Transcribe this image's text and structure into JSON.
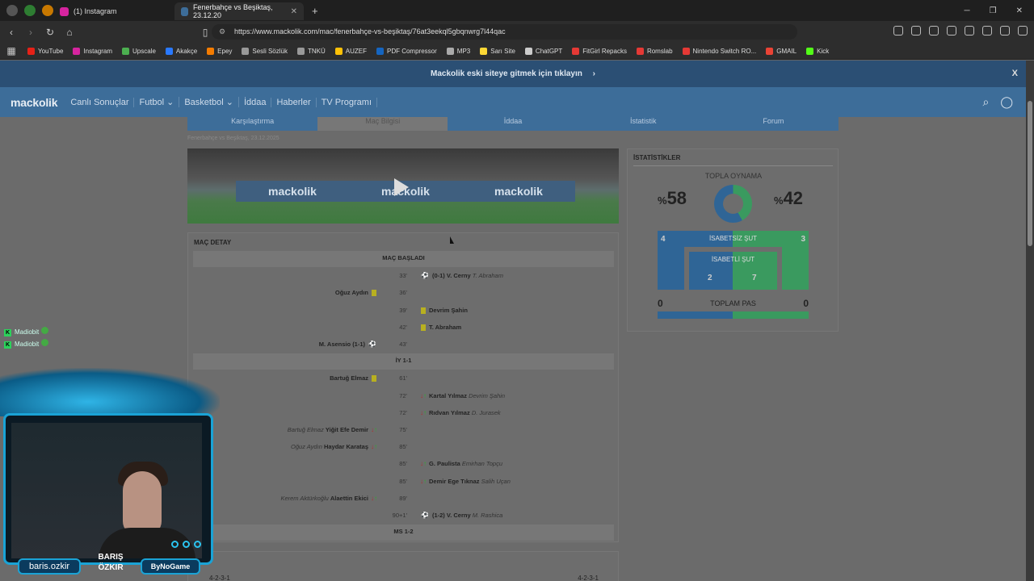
{
  "browser": {
    "tabs": [
      {
        "title": "(1) Instagram",
        "color": "#d6249f"
      },
      {
        "title": "Fenerbahçe vs Beşiktaş, 23.12.20",
        "color": "#3d6d99"
      }
    ],
    "new_tab": "+",
    "url": "https://www.mackolik.com/mac/fenerbahçe-vs-beşiktaş/76at3eekql5gbqnwrg7l44qac",
    "bookmarks": [
      {
        "label": "YouTube",
        "color": "#e62117"
      },
      {
        "label": "Instagram",
        "color": "#d6249f"
      },
      {
        "label": "Upscale",
        "color": "#4caf50"
      },
      {
        "label": "Akakçe",
        "color": "#2979ff"
      },
      {
        "label": "Epey",
        "color": "#f57c00"
      },
      {
        "label": "Sesli Sözlük",
        "color": "#999999"
      },
      {
        "label": "TNKÜ",
        "color": "#999999"
      },
      {
        "label": "AUZEF",
        "color": "#ffc107"
      },
      {
        "label": "PDF Compressor",
        "color": "#1565c0"
      },
      {
        "label": "MP3",
        "color": "#aaaaaa"
      },
      {
        "label": "Sarı Site",
        "color": "#fdd835"
      },
      {
        "label": "ChatGPT",
        "color": "#cccccc"
      },
      {
        "label": "FitGirl Repacks",
        "color": "#e53935"
      },
      {
        "label": "Romslab",
        "color": "#e53935"
      },
      {
        "label": "Nintendo Switch RO...",
        "color": "#e53935"
      },
      {
        "label": "GMAIL",
        "color": "#ea4335"
      },
      {
        "label": "Kick",
        "color": "#53fc18"
      }
    ]
  },
  "banner": {
    "text": "Mackolik eski siteye gitmek için tıklayın",
    "close": "X"
  },
  "nav": {
    "logo": "mackolik",
    "links": [
      "Canlı Sonuçlar",
      "Futbol ⌄",
      "Basketbol ⌄",
      "İddaa",
      "Haberler",
      "TV Programı"
    ]
  },
  "subtabs": [
    "Karşılaştırma",
    "Maç Bilgisi",
    "İddaa",
    "İstatistik",
    "Forum"
  ],
  "breadcrumb": "Fenerbahçe vs Beşiktaş, 23.12.2025",
  "video": {
    "brand": "mackolik"
  },
  "match_detail": {
    "title": "MAÇ DETAY",
    "events": [
      {
        "type": "hdr",
        "text": "MAÇ BAŞLADI"
      },
      {
        "min": "33'",
        "side": "r",
        "kind": "goal",
        "score": "(0-1)",
        "player": "V. Cerny",
        "assist": "T. Abraham"
      },
      {
        "min": "36'",
        "side": "l",
        "kind": "card",
        "player": "Oğuz Aydın"
      },
      {
        "min": "39'",
        "side": "r",
        "kind": "card",
        "player": "Devrim Şahin"
      },
      {
        "min": "42'",
        "side": "r",
        "kind": "card",
        "player": "T. Abraham"
      },
      {
        "min": "43'",
        "side": "l",
        "kind": "pen",
        "player": "M. Asensio",
        "score": "(1-1)"
      },
      {
        "type": "hdr",
        "text": "İY 1-1"
      },
      {
        "min": "61'",
        "side": "l",
        "kind": "card",
        "player": "Bartuğ Elmaz"
      },
      {
        "min": "72'",
        "side": "r",
        "kind": "sub",
        "player": "Kartal Yılmaz",
        "assist": "Devrim Şahin"
      },
      {
        "min": "72'",
        "side": "r",
        "kind": "sub",
        "player": "Rıdvan Yılmaz",
        "assist": "D. Jurasek"
      },
      {
        "min": "75'",
        "side": "l",
        "kind": "sub",
        "player": "Yiğit Efe Demir",
        "assist": "Bartuğ Elmaz"
      },
      {
        "min": "85'",
        "side": "l",
        "kind": "sub",
        "player": "Haydar Karataş",
        "assist": "Oğuz Aydın"
      },
      {
        "min": "85'",
        "side": "r",
        "kind": "sub",
        "player": "G. Paulista",
        "assist": "Emirhan Topçu"
      },
      {
        "min": "85'",
        "side": "r",
        "kind": "sub",
        "player": "Demir Ege Tıknaz",
        "assist": "Salih Uçan"
      },
      {
        "min": "89'",
        "side": "l",
        "kind": "sub",
        "player": "Alaettin Ekici",
        "assist": "Kerem Aktürkoğlu"
      },
      {
        "min": "90+1'",
        "side": "r",
        "kind": "goal",
        "score": "(1-2)",
        "player": "V. Cerny",
        "assist": "M. Rashica"
      },
      {
        "type": "hdr",
        "text": "MS 1-2"
      }
    ]
  },
  "stats": {
    "title": "İSTATİSTİKLER",
    "possession_title": "TOPLA OYNAMA",
    "home_pct": "58",
    "away_pct": "42",
    "pct_sign": "%",
    "off_target_label": "İSABETSİZ ŞUT",
    "on_target_label": "İSABETLİ ŞUT",
    "home_off": "4",
    "away_off": "3",
    "home_on": "2",
    "away_on": "7",
    "pass_label": "TOPLAM PAS",
    "home_pass": "0",
    "away_pass": "0"
  },
  "formation": {
    "home": "4-2-3-1",
    "away": "4-2-3-1"
  },
  "stream": {
    "chat": [
      {
        "user": "Madiobit"
      },
      {
        "user": "Madiobit"
      }
    ],
    "handle": "baris.ozkir",
    "name_line1": "BARIŞ",
    "name_line2": "ÖZKIR",
    "sponsor": "ByNoGame"
  }
}
